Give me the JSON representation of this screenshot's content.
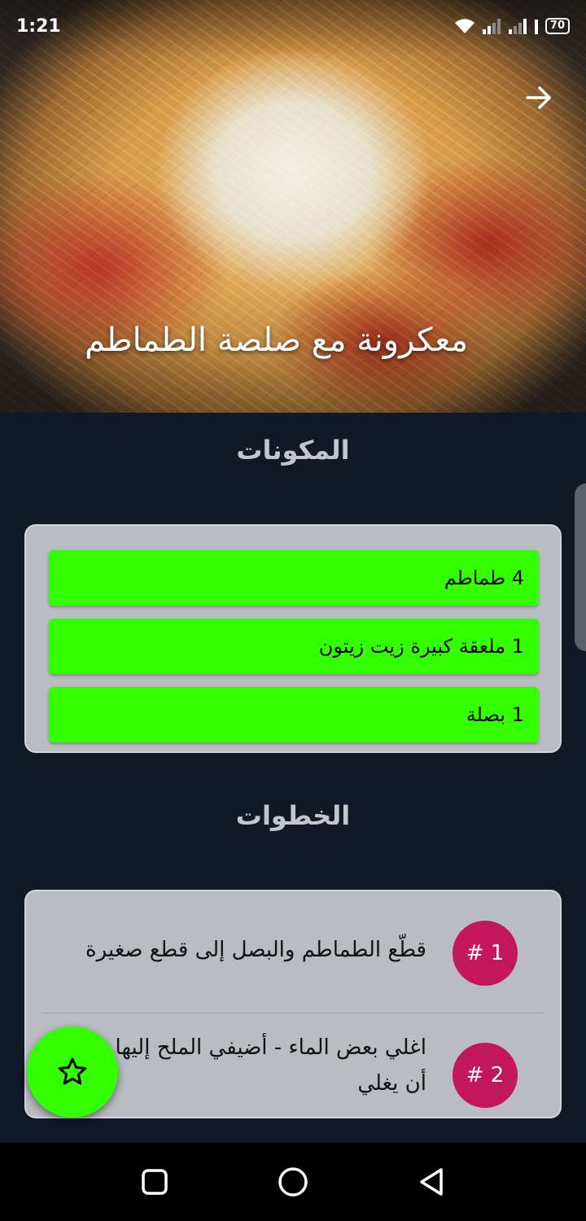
{
  "status_bar": {
    "time": "1:21",
    "battery": "70",
    "icons": [
      "wifi-icon",
      "signal-icon",
      "signal-icon",
      "notification-icon",
      "battery-icon"
    ]
  },
  "header": {
    "title": "معكرونة مع صلصة الطماطم",
    "back_icon": "arrow-right-icon"
  },
  "ingredients": {
    "title": "المكونات",
    "items": [
      "4 طماطم",
      "1 ملعقة كبيرة زيت زيتون",
      "1 بصلة"
    ]
  },
  "steps": {
    "title": "الخطوات",
    "items": [
      {
        "number": "# 1",
        "text": "قطّع الطماطم والبصل إلى قطع صغيرة"
      },
      {
        "number": "# 2",
        "text": "اغلي بعض الماء - أضيفي الملح إليها بمجرد أن يغلي"
      }
    ]
  },
  "fab": {
    "icon": "star-icon"
  },
  "nav_bar": {
    "icons": [
      "recents-square-icon",
      "home-circle-icon",
      "back-triangle-icon"
    ]
  },
  "colors": {
    "background": "#111827",
    "card": "#b9bcc1",
    "ingredient": "#33ff00",
    "badge": "#c2185b",
    "fab": "#33ff00"
  }
}
